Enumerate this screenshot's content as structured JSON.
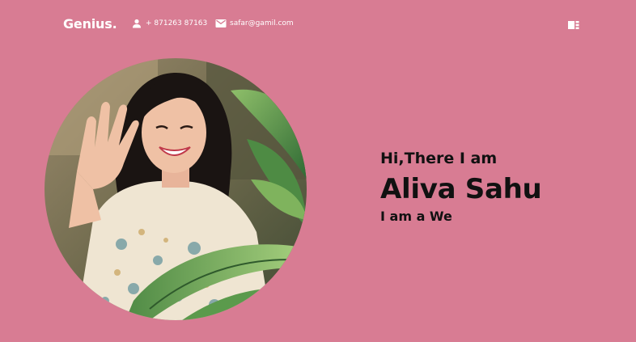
{
  "header": {
    "logo": "Genius.",
    "phone": "+ 871263 87163",
    "phone_icon": "person-icon",
    "email": "safar@gamil.com",
    "email_icon": "mail-icon",
    "menu_icon": "menu-icon"
  },
  "hero": {
    "greeting": "Hi,There I am",
    "name": "Aliva Sahu",
    "role": "I am a We"
  },
  "colors": {
    "background": "#d87c93",
    "header_text": "#ffffff",
    "hero_text": "#111111"
  }
}
